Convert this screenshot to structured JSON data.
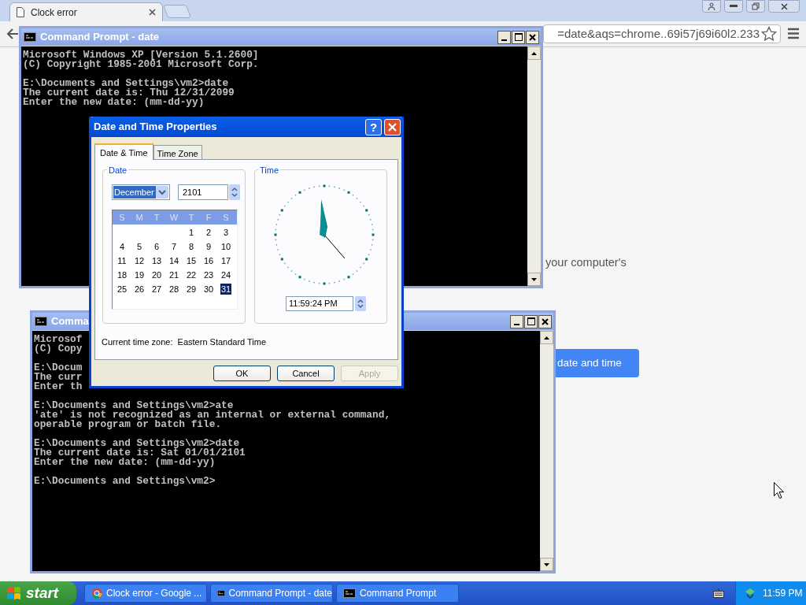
{
  "browser": {
    "tab_title": "Clock error",
    "address": "=date&aqs=chrome..69i57j69i60l2.233",
    "page_text": "your computer's",
    "page_button": "date and time"
  },
  "consoles": [
    {
      "title": "Command Prompt - date",
      "blocks": [
        [
          "Microsoft Windows XP [Version 5.1.2600]",
          "(C) Copyright 1985-2001 Microsoft Corp."
        ],
        [
          "E:\\Documents and Settings\\vm2>date",
          "The current date is: Thu 12/31/2099",
          "Enter the new date: (mm-dd-yy)"
        ]
      ]
    },
    {
      "title": "Comma",
      "blocks": [
        [
          "Microsof",
          "(C) Copy"
        ],
        [
          "E:\\Docum",
          "The curr",
          "Enter th"
        ],
        [
          "E:\\Documents and Settings\\vm2>ate",
          "'ate' is not recognized as an internal or external command,",
          "operable program or batch file."
        ],
        [
          "E:\\Documents and Settings\\vm2>date",
          "The current date is: Sat 01/01/2101",
          "Enter the new date: (mm-dd-yy)"
        ],
        [
          "E:\\Documents and Settings\\vm2>"
        ]
      ]
    }
  ],
  "dialog": {
    "title": "Date and Time Properties",
    "help": "?",
    "tabs": [
      {
        "label": "Date & Time",
        "selected": true
      },
      {
        "label": "Time Zone",
        "selected": false
      }
    ],
    "date_group": "Date",
    "month": "December",
    "year": "2101",
    "weekdays": [
      "S",
      "M",
      "T",
      "W",
      "T",
      "F",
      "S"
    ],
    "days": [
      {
        "label": "1",
        "selected": false
      },
      {
        "label": "2",
        "selected": false
      },
      {
        "label": "3",
        "selected": false
      },
      {
        "label": "4",
        "selected": false
      },
      {
        "label": "5",
        "selected": false
      },
      {
        "label": "6",
        "selected": false
      },
      {
        "label": "7",
        "selected": false
      },
      {
        "label": "8",
        "selected": false
      },
      {
        "label": "9",
        "selected": false
      },
      {
        "label": "10",
        "selected": false
      },
      {
        "label": "11",
        "selected": false
      },
      {
        "label": "12",
        "selected": false
      },
      {
        "label": "13",
        "selected": false
      },
      {
        "label": "14",
        "selected": false
      },
      {
        "label": "15",
        "selected": false
      },
      {
        "label": "16",
        "selected": false
      },
      {
        "label": "17",
        "selected": false
      },
      {
        "label": "18",
        "selected": false
      },
      {
        "label": "19",
        "selected": false
      },
      {
        "label": "20",
        "selected": false
      },
      {
        "label": "21",
        "selected": false
      },
      {
        "label": "22",
        "selected": false
      },
      {
        "label": "23",
        "selected": false
      },
      {
        "label": "24",
        "selected": false
      },
      {
        "label": "25",
        "selected": false
      },
      {
        "label": "26",
        "selected": false
      },
      {
        "label": "27",
        "selected": false
      },
      {
        "label": "28",
        "selected": false
      },
      {
        "label": "29",
        "selected": false
      },
      {
        "label": "30",
        "selected": false
      },
      {
        "label": "31",
        "selected": true
      }
    ],
    "time_group": "Time",
    "time": "11:59:24 PM",
    "time_zone": "Current time zone:  Eastern Standard Time",
    "buttons": [
      {
        "label": "OK",
        "disabled": false
      },
      {
        "label": "Cancel",
        "disabled": false
      },
      {
        "label": "Apply",
        "disabled": true
      }
    ]
  },
  "taskbar": {
    "start": "start",
    "tasks": [
      {
        "label": "Clock error - Google ...",
        "kind": "browser"
      },
      {
        "label": "Command Prompt - date",
        "kind": "console"
      },
      {
        "label": "Command Prompt",
        "kind": "console"
      }
    ],
    "clock": "11:59 PM"
  }
}
